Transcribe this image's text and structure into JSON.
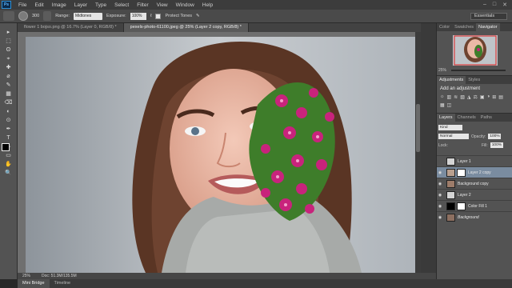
{
  "menu": {
    "logo": "Ps",
    "items": [
      "File",
      "Edit",
      "Image",
      "Layer",
      "Type",
      "Select",
      "Filter",
      "View",
      "Window",
      "Help"
    ],
    "controls": [
      "–",
      "□",
      "✕"
    ]
  },
  "options": {
    "size": "300",
    "range_label": "Range:",
    "range_value": "Midtones",
    "exposure_label": "Exposure:",
    "exposure_value": "100%",
    "protect_label": "Protect Tones",
    "workspace": "Essentials"
  },
  "tabs": [
    {
      "label": "flower 1 bojso.png @ 16.7% (Layer 0, RGB/8) *"
    },
    {
      "label": "pexels-photo-61100.jpeg @ 25% (Layer 2 copy, RGB/8) *"
    }
  ],
  "tools": [
    "▸",
    "⬚",
    "ʘ",
    "⌖",
    "✚",
    "⌀",
    "✎",
    "▦",
    "⌫",
    "◐",
    "⊙",
    "✒",
    "T",
    "▶",
    "▭",
    "✋",
    "🔍"
  ],
  "status": {
    "zoom": "25%",
    "doc": "Doc: 51.3M/135.5M"
  },
  "bottom_tabs": [
    "Mini Bridge",
    "Timeline"
  ],
  "right_panels": {
    "top_tabs": [
      "Color",
      "Swatches",
      "Navigator"
    ],
    "nav_zoom": "25%",
    "adj_tabs": [
      "Adjustments",
      "Styles"
    ],
    "adj_title": "Add an adjustment",
    "adj_icons": [
      "☼",
      "▥",
      "≋",
      "▧",
      "◮",
      "⚖",
      "▣",
      "◑",
      "⊞",
      "▤",
      "▦",
      "◫"
    ],
    "layer_tabs": [
      "Layers",
      "Channels",
      "Paths"
    ],
    "kind": "Kind",
    "blend": "Normal",
    "opacity_label": "Opacity:",
    "opacity": "100%",
    "lock_label": "Lock:",
    "fill_label": "Fill:",
    "fill": "100%",
    "layers": [
      {
        "name": "Layer 1"
      },
      {
        "name": "Layer 2 copy"
      },
      {
        "name": "Background copy"
      },
      {
        "name": "Layer 2"
      },
      {
        "name": "Color Fill 1"
      },
      {
        "name": "Background"
      }
    ]
  }
}
